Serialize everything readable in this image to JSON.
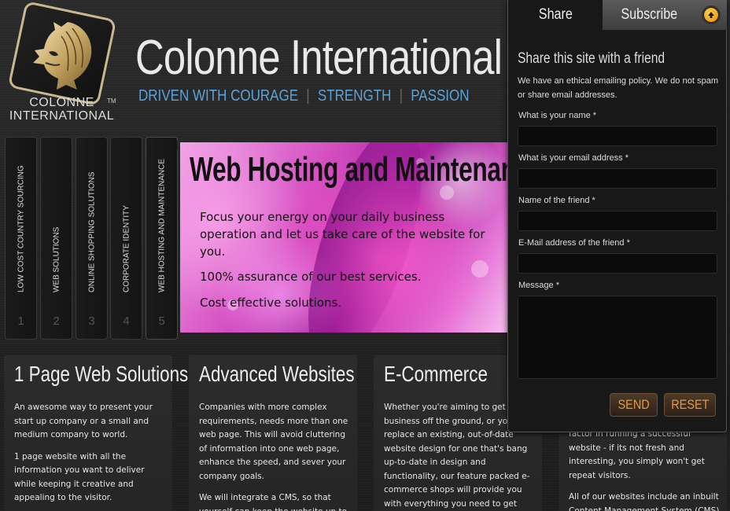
{
  "brand": {
    "logo_line1": "COLONNE",
    "logo_line2": "INTERNATIONAL",
    "tm": "TM",
    "site_title": "Colonne International",
    "tagline": [
      "DRIVEN WITH COURAGE",
      "STRENGTH",
      "PASSION"
    ],
    "tagline_color": "#5aa3d8"
  },
  "vnav": {
    "tabs": [
      {
        "label": "LOW COST COUNTRY SOURCING",
        "num": "1"
      },
      {
        "label": "WEB SOLUTIONS",
        "num": "2"
      },
      {
        "label": "ONLINE SHOPPING SOLUTIONS",
        "num": "3"
      },
      {
        "label": "CORPORATE IDENTITY",
        "num": "4"
      },
      {
        "label": "WEB HOSTING AND MAINTENANCE",
        "num": "5"
      }
    ]
  },
  "hero": {
    "title": "Web Hosting and Maintenance",
    "lines": [
      "Focus your energy on your daily business operation and let us take care of the website for you.",
      "100% assurance of our best services.",
      "Cost effective solutions."
    ]
  },
  "columns": [
    {
      "title": "1 Page Web Solutions",
      "paragraphs": [
        "An awesome way to present your start up company or a small and medium company to world.",
        "1 page website with all the information you want to deliver while keeping it creative and appealing to the visitor."
      ]
    },
    {
      "title": "Advanced Websites",
      "paragraphs": [
        "Companies with more complex requirements, needs more than one web page. This will avoid cluttering of information into one web page, enhance the speed, and sever your company goals.",
        "We will integrate a CMS, so that yourself can keep the website up to"
      ]
    },
    {
      "title": "E-Commerce",
      "paragraphs": [
        "Whether you're aiming to get a business off the ground, or you're to replace an existing, out-of-date website design for one that's bang up-to-date in design and functionality, our feature packed e-commerce shops will provide you with everything you need to get"
      ]
    },
    {
      "title": "",
      "paragraphs": [
        "factor in running a successful website - if its not fresh and interesting, you simply won't get repeat visitors.",
        "All of our websites include an inbuilt Content Management System (CMS)"
      ]
    }
  ],
  "share_panel": {
    "tab_share": "Share",
    "tab_subscribe": "Subscribe",
    "heading": "Share this site with a friend",
    "note": "We have an ethical emailing policy. We do not spam or share email addresses.",
    "fields": [
      {
        "label": "What is your name *",
        "value": ""
      },
      {
        "label": "What is your email address *",
        "value": ""
      },
      {
        "label": "Name of the friend *",
        "value": ""
      },
      {
        "label": "E-Mail address of the friend *",
        "value": ""
      },
      {
        "label": "Message *",
        "value": ""
      }
    ],
    "send_label": "SEND",
    "reset_label": "RESET",
    "accent_color": "#e79a3c"
  }
}
